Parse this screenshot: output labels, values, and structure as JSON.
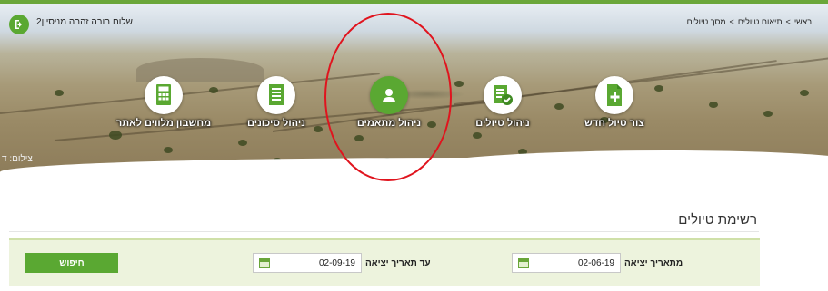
{
  "header": {
    "greeting": "שלום בובה זהבה מניסיון2",
    "breadcrumb": [
      {
        "label": "ראשי"
      },
      {
        "label": ">"
      },
      {
        "label": "תיאום טיולים"
      },
      {
        "label": ">"
      },
      {
        "label": "מסך טיולים"
      }
    ],
    "watermark": "צילום: ד"
  },
  "nav": [
    {
      "label": "צור טיול חדש",
      "icon": "new-document-icon"
    },
    {
      "label": "ניהול טיולים",
      "icon": "checklist-icon"
    },
    {
      "label": "ניהול מתאמים",
      "icon": "user-icon"
    },
    {
      "label": "ניהול סיכונים",
      "icon": "document-icon"
    },
    {
      "label": "מחשבון מלווים לאתר",
      "icon": "calculator-icon"
    }
  ],
  "main": {
    "title": "רשימת טיולים",
    "filters": {
      "from_label": "מתאריך יציאה",
      "from_value": "02-06-19",
      "to_label": "עד תאריך יציאה",
      "to_value": "02-09-19",
      "search_label": "חיפוש"
    }
  },
  "colors": {
    "accent": "#5aa832",
    "annotation": "#e0141e",
    "filter_bg": "#edf3dd"
  }
}
